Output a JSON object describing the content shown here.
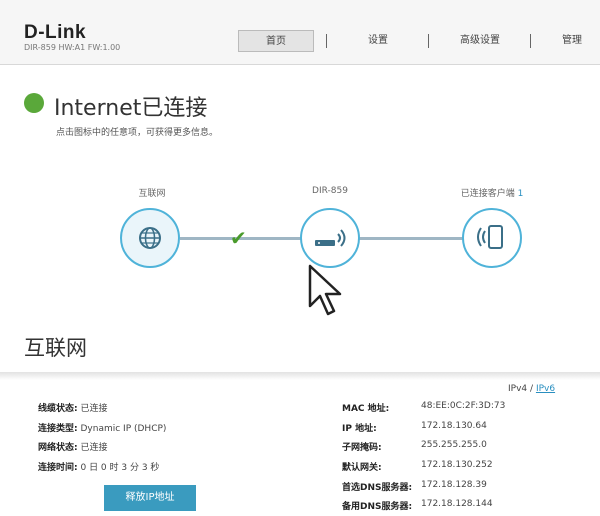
{
  "header": {
    "brand": "D-Link",
    "model": "DIR-859   HW:A1   FW:1.00",
    "nav": [
      "首页",
      "设置",
      "高级设置",
      "管理"
    ]
  },
  "status": {
    "title": "Internet已连接",
    "subtitle": "点击图标中的任意项，可获得更多信息。"
  },
  "topology": {
    "wan_label": "互联网",
    "router_label": "DIR-859",
    "clients_label": "已连接客户端",
    "clients_count": "1"
  },
  "internet": {
    "section_title": "互联网",
    "ipv4": "IPv4",
    "ipv_sep": "/",
    "ipv6": "IPv6",
    "left": [
      {
        "key": "线缆状态:",
        "value": "已连接"
      },
      {
        "key": "连接类型:",
        "value": "Dynamic IP (DHCP)"
      },
      {
        "key": "网络状态:",
        "value": "已连接"
      },
      {
        "key": "连接时间:",
        "value": "0 日 0 时 3 分 3 秒"
      }
    ],
    "right": [
      {
        "key": "MAC 地址:",
        "value": "48:EE:0C:2F:3D:73"
      },
      {
        "key": "IP 地址:",
        "value": "172.18.130.64"
      },
      {
        "key": "子网掩码:",
        "value": "255.255.255.0"
      },
      {
        "key": "默认网关:",
        "value": "172.18.130.252"
      },
      {
        "key": "首选DNS服务器:",
        "value": "172.18.128.39"
      },
      {
        "key": "备用DNS服务器:",
        "value": "172.18.128.144"
      }
    ],
    "release_button": "释放IP地址"
  },
  "colors": {
    "status_green": "#5aa83a",
    "accent_blue": "#4fb3d9",
    "button_blue": "#3a9bbf"
  }
}
